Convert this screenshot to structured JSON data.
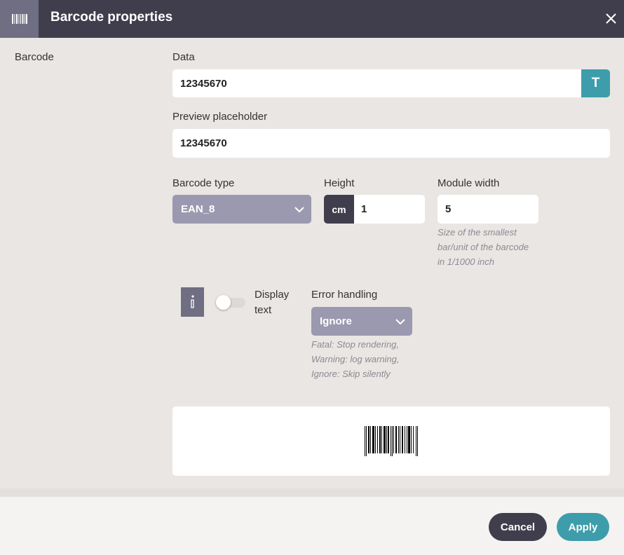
{
  "header": {
    "title": "Barcode properties",
    "icon": "barcode-icon",
    "close_icon": "close-icon"
  },
  "section": {
    "label": "Barcode"
  },
  "data_field": {
    "label": "Data",
    "value": "12345670",
    "button_label": "T"
  },
  "preview_field": {
    "label": "Preview placeholder",
    "value": "12345670"
  },
  "barcode_type": {
    "label": "Barcode type",
    "value": "EAN_8"
  },
  "height": {
    "label": "Height",
    "unit": "cm",
    "value": "1"
  },
  "module_width": {
    "label": "Module width",
    "value": "5",
    "help_lines": [
      "Size of the smallest",
      "bar/unit of the barcode",
      "in 1/1000 inch"
    ]
  },
  "display_text": {
    "label_line1": "Display",
    "label_line2": "text",
    "enabled": false,
    "info_icon": "info-icon"
  },
  "error_handling": {
    "label": "Error handling",
    "value": "Ignore",
    "help_lines": [
      "Fatal: Stop rendering,",
      "Warning: log warning,",
      "Ignore: Skip silently"
    ]
  },
  "footer": {
    "cancel_label": "Cancel",
    "apply_label": "Apply"
  },
  "colors": {
    "header_bg": "#403e4d",
    "accent": "#3d9dab",
    "select_bg": "#9b99af"
  }
}
